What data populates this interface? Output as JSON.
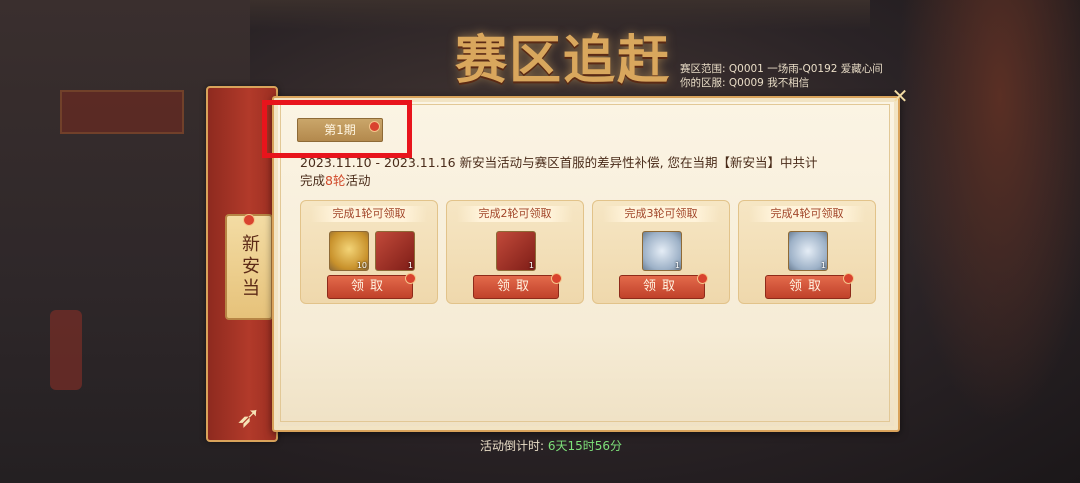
{
  "header": {
    "title": "赛区追赶",
    "server_range": "赛区范围: Q0001 一场雨-Q0192 爱藏心间",
    "your_server": "你的区服: Q0009 我不相信"
  },
  "sidebar": {
    "tab_label": "新安当"
  },
  "period_tab": {
    "label": "第1期"
  },
  "description": {
    "line1": "2023.11.10 - 2023.11.16 新安当活动与赛区首服的差异性补偿, 您在当期【新安当】中共计",
    "line2_prefix": "完成",
    "line2_highlight": "8轮",
    "line2_suffix": "活动"
  },
  "cards": [
    {
      "title": "完成1轮可领取",
      "button": "领取",
      "items": [
        {
          "icon": "gold-paper-icon",
          "qty": "10"
        },
        {
          "icon": "red-chest-icon",
          "qty": "1"
        }
      ]
    },
    {
      "title": "完成2轮可领取",
      "button": "领取",
      "items": [
        {
          "icon": "red-chest-icon",
          "qty": "1"
        }
      ]
    },
    {
      "title": "完成3轮可领取",
      "button": "领取",
      "items": [
        {
          "icon": "silver-chest-icon",
          "qty": "1"
        }
      ]
    },
    {
      "title": "完成4轮可领取",
      "button": "领取",
      "items": [
        {
          "icon": "silver-chest-icon",
          "qty": "1"
        }
      ]
    }
  ],
  "countdown": {
    "label": "活动倒计时: ",
    "value": "6天15时56分"
  },
  "close_icon": "close-icon",
  "colors": {
    "accent_gold": "#d9a35b",
    "claim_red": "#c0412a",
    "highlight_box": "#e8141c",
    "countdown_green": "#7ee07a"
  }
}
